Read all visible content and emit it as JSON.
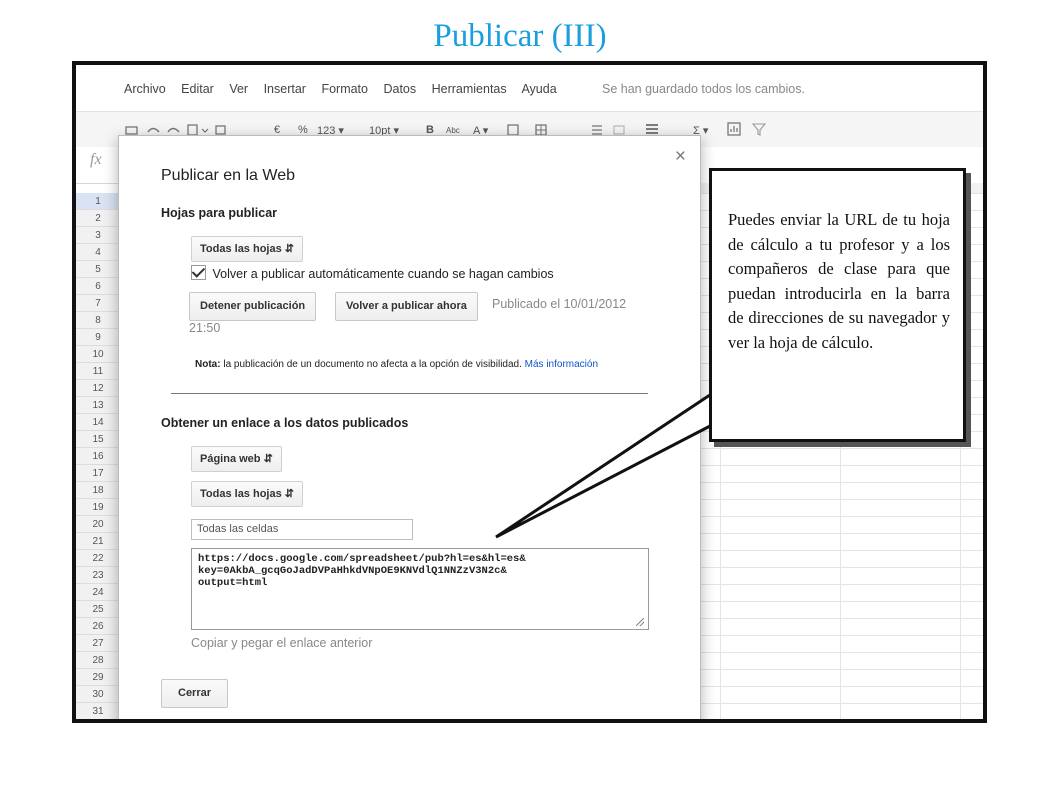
{
  "slide": {
    "title": "Publicar (III)"
  },
  "menubar": {
    "items": [
      "Archivo",
      "Editar",
      "Ver",
      "Insertar",
      "Formato",
      "Datos",
      "Herramientas",
      "Ayuda"
    ],
    "status": "Se han guardado todos los cambios."
  },
  "toolbar": {
    "currency": "€",
    "percent": "%",
    "number_format": "123 ▾",
    "font_size": "10pt ▾",
    "bold": "B",
    "strike": "Abc",
    "text_color": "A ▾",
    "sum": "Σ ▾"
  },
  "formula": {
    "fx": "fx"
  },
  "rows": [
    "1",
    "2",
    "3",
    "4",
    "5",
    "6",
    "7",
    "8",
    "9",
    "10",
    "11",
    "12",
    "13",
    "14",
    "15",
    "16",
    "17",
    "18",
    "19",
    "20",
    "21",
    "22",
    "23",
    "24",
    "25",
    "26",
    "27",
    "28",
    "29",
    "30",
    "31"
  ],
  "dialog": {
    "title": "Publicar en la Web",
    "close": "×",
    "sheets_heading": "Hojas para publicar",
    "sheets_select": "Todas las hojas",
    "auto_republish": "Volver a publicar automáticamente cuando se hagan cambios",
    "stop_button": "Detener publicación",
    "republish_button": "Volver a publicar ahora",
    "published_on": "Publicado el 10/01/2012",
    "published_time": "21:50",
    "note_label": "Nota:",
    "note_text": " la publicación de un documento no afecta a la opción de visibilidad. ",
    "note_link": "Más información",
    "link_heading": "Obtener un enlace a los datos publicados",
    "format_select": "Página web",
    "sheets_select_2": "Todas las hojas",
    "range_field": "Todas las celdas",
    "url_lines": [
      "https://docs.google.com/spreadsheet/pub?hl=es&hl=es&",
      "key=0AkbA_gcqGoJadDVPaHhkdVNpOE9KNVdlQ1NNZzV3N2c&",
      "output=html"
    ],
    "copy_hint": "Copiar y pegar el enlace anterior",
    "close_button": "Cerrar"
  },
  "callout": {
    "text": "Puedes enviar la URL de tu hoja de cálculo a tu profesor y a los compañeros de clase para que puedan introducirla en la barra de direcciones de su navegador y ver la hoja de cálculo."
  },
  "colors": {
    "title": "#1a9ede",
    "link": "#1155cc"
  }
}
